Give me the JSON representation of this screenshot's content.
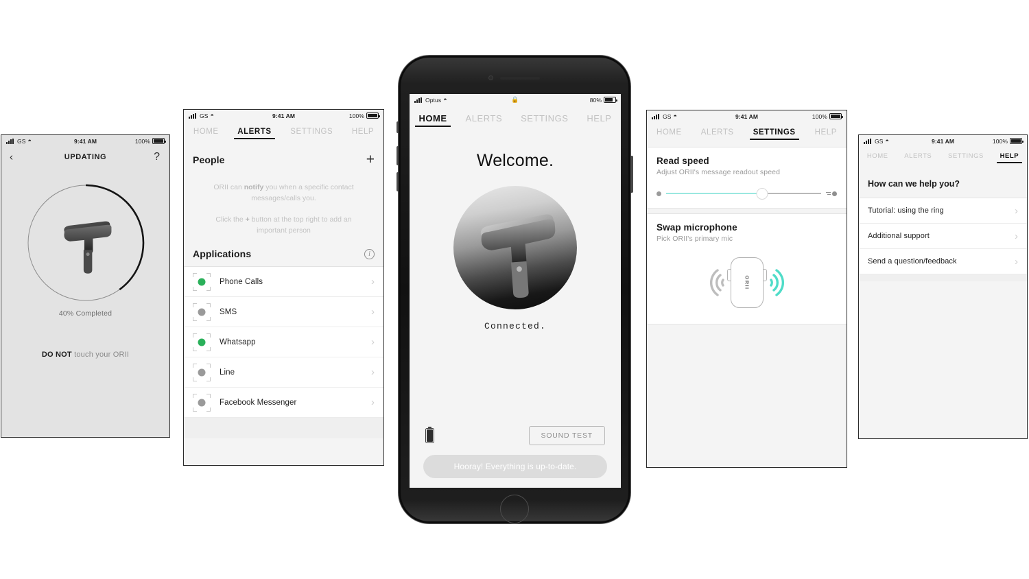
{
  "screens": {
    "updating": {
      "status": {
        "carrier": "GS",
        "time": "9:41 AM",
        "battery": "100%"
      },
      "back_icon": "chevron-left-icon",
      "title": "UPDATING",
      "help_icon": "?",
      "progress_percent": 40,
      "progress_label": "40% Completed",
      "warning_strong": "DO NOT",
      "warning_rest": " touch your ORII"
    },
    "alerts": {
      "status": {
        "carrier": "GS",
        "time": "9:41 AM",
        "battery": "100%"
      },
      "tabs": [
        {
          "label": "HOME",
          "active": false
        },
        {
          "label": "ALERTS",
          "active": true
        },
        {
          "label": "SETTINGS",
          "active": false
        },
        {
          "label": "HELP",
          "active": false
        }
      ],
      "people": {
        "title": "People",
        "add_label": "+",
        "empty_line1_a": "ORII can ",
        "empty_line1_b": "notify",
        "empty_line1_c": " you when a specific contact messages/calls you.",
        "empty_line2_a": "Click the ",
        "empty_line2_b": "+",
        "empty_line2_c": " button at the top right to add an important person"
      },
      "applications": {
        "title": "Applications",
        "info_label": "i",
        "items": [
          {
            "name": "Phone Calls",
            "enabled": true
          },
          {
            "name": "SMS",
            "enabled": false
          },
          {
            "name": "Whatsapp",
            "enabled": true
          },
          {
            "name": "Line",
            "enabled": false
          },
          {
            "name": "Facebook Messenger",
            "enabled": false
          }
        ]
      }
    },
    "home": {
      "status": {
        "carrier": "Optus",
        "time_icon": "lock-icon",
        "battery": "80%"
      },
      "tabs": [
        {
          "label": "HOME",
          "active": true
        },
        {
          "label": "ALERTS",
          "active": false
        },
        {
          "label": "SETTINGS",
          "active": false
        },
        {
          "label": "HELP",
          "active": false
        }
      ],
      "welcome": "Welcome.",
      "connection_status": "Connected.",
      "sound_test_label": "SOUND TEST",
      "ring_battery_percent": 100,
      "toast": "Hooray! Everything is up-to-date."
    },
    "settings": {
      "status": {
        "carrier": "GS",
        "time": "9:41 AM",
        "battery": "100%"
      },
      "tabs": [
        {
          "label": "HOME",
          "active": false
        },
        {
          "label": "ALERTS",
          "active": false
        },
        {
          "label": "SETTINGS",
          "active": true
        },
        {
          "label": "HELP",
          "active": false
        }
      ],
      "read_speed": {
        "title": "Read speed",
        "subtitle": "Adjust ORII's message readout speed",
        "value_percent": 62
      },
      "swap_microphone": {
        "title": "Swap microphone",
        "subtitle": "Pick ORII's primary mic",
        "device_brand": "ORII",
        "left_active": false,
        "right_active": true
      }
    },
    "help": {
      "status": {
        "carrier": "GS",
        "time": "9:41 AM",
        "battery": "100%"
      },
      "tabs": [
        {
          "label": "HOME",
          "active": false
        },
        {
          "label": "ALERTS",
          "active": false
        },
        {
          "label": "SETTINGS",
          "active": false
        },
        {
          "label": "HELP",
          "active": true
        }
      ],
      "question": "How can we help you?",
      "items": [
        {
          "label": "Tutorial: using the ring"
        },
        {
          "label": "Additional support"
        },
        {
          "label": "Send a question/feedback"
        }
      ]
    }
  },
  "colors": {
    "accent_green": "#2ab05a",
    "accent_teal": "#4fdcc8",
    "slider_fill": "#9ae8e0",
    "disabled_dot": "#9a9a9a",
    "text_dark": "#1b1b1b",
    "text_muted": "#9b9b9b"
  }
}
